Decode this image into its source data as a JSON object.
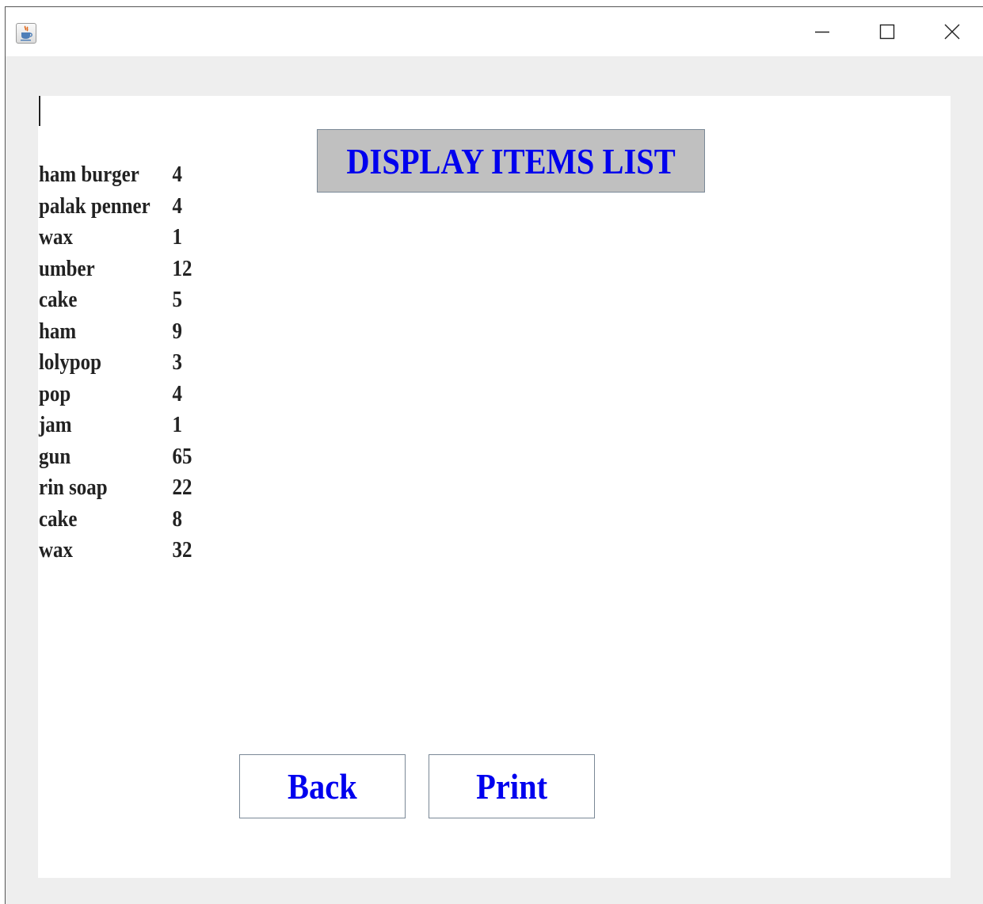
{
  "window": {
    "icon": "java-coffee-icon",
    "controls": [
      "minimize-icon",
      "maximize-icon",
      "close-icon"
    ]
  },
  "heading": "DISPLAY ITEMS LIST",
  "items": [
    {
      "name": "ham burger",
      "qty": "4"
    },
    {
      "name": "palak penner",
      "qty": "4"
    },
    {
      "name": "wax",
      "qty": "1"
    },
    {
      "name": "umber",
      "qty": "12"
    },
    {
      "name": "cake",
      "qty": "5"
    },
    {
      "name": "ham",
      "qty": "9"
    },
    {
      "name": "lolypop",
      "qty": "3"
    },
    {
      "name": "pop",
      "qty": "4"
    },
    {
      "name": "jam",
      "qty": "1"
    },
    {
      "name": "gun",
      "qty": "65"
    },
    {
      "name": "rin soap",
      "qty": "22"
    },
    {
      "name": "cake",
      "qty": "8"
    },
    {
      "name": "wax",
      "qty": "32"
    }
  ],
  "buttons": {
    "back": "Back",
    "print": "Print"
  },
  "colors": {
    "label_blue": "#0000ee",
    "heading_bg": "#c0c0c0",
    "frame_bg": "#eeeeee"
  }
}
